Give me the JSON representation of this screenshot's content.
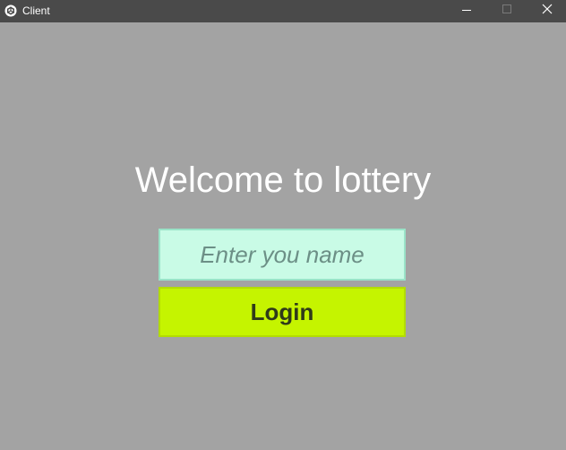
{
  "window": {
    "title": "Client",
    "icons": {
      "app": "unity-icon",
      "minimize": "minimize-icon",
      "maximize": "maximize-icon",
      "close": "close-icon"
    }
  },
  "main": {
    "welcome_text": "Welcome to lottery",
    "name_input": {
      "value": "",
      "placeholder": "Enter you name"
    },
    "login_label": "Login"
  },
  "colors": {
    "background": "#a3a3a3",
    "titlebar": "#4a4a4a",
    "input_background": "#c9fbe6",
    "button_background": "#c5f400",
    "welcome_text": "#ffffff"
  }
}
